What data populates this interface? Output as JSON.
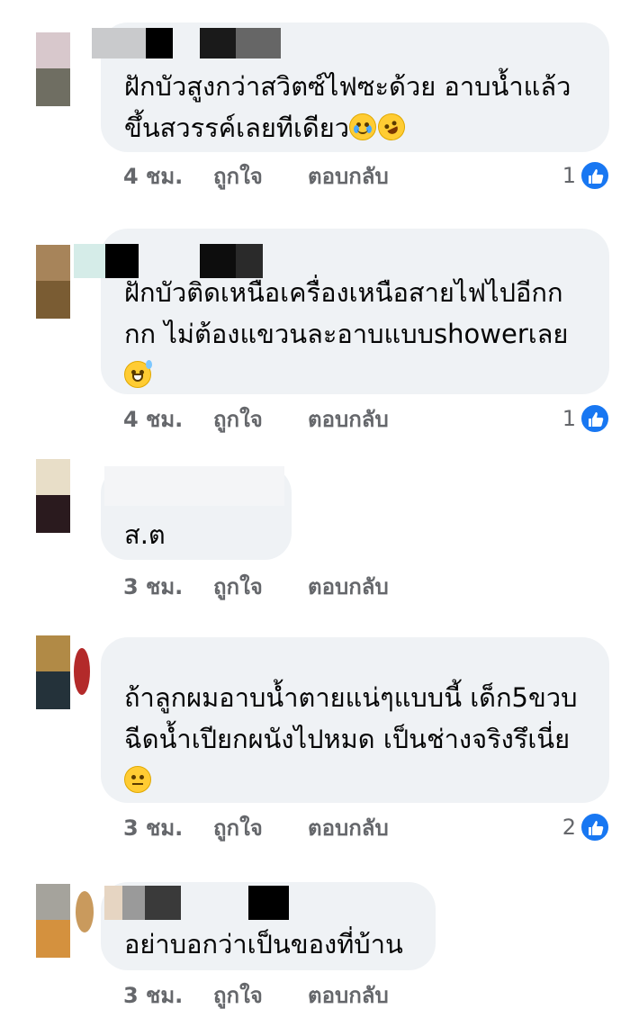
{
  "labels": {
    "like": "ถูกใจ",
    "reply": "ตอบกลับ"
  },
  "colors": {
    "bubble": "#eff2f5",
    "meta_text": "#65676b",
    "like_badge": "#1877f2"
  },
  "comments": [
    {
      "text": "ฝักบัวสูงกว่าสวิตซ์ไฟซะด้วย อาบน้ำแล้ว\nขึ้นสวรรค์เลยทีเดียว",
      "emojis": [
        "crying-face",
        "rolling-laughing-face"
      ],
      "time": "4 ชม.",
      "reactions": "1",
      "reaction_icon": "like-icon"
    },
    {
      "text": "ฝักบัวติดเหนือเครื่องเหนือสายไฟไปอีกก\nกก ไม่ต้องแขวนละอาบแบบshowerเลย",
      "emojis": [
        "grinning-sweat-face"
      ],
      "time": "4 ชม.",
      "reactions": "1",
      "reaction_icon": "like-icon"
    },
    {
      "text": "ส.ต",
      "emojis": [],
      "time": "3 ชม.",
      "reactions": "",
      "reaction_icon": ""
    },
    {
      "text": "ถ้าลูกผมอาบน้ำตายแน่ๆแบบนี้ เด็ก5ขวบ\nฉีดน้ำเปียกผนังไปหมด เป็นช่างจริงรึเนี่ย",
      "emojis": [
        "expressionless-face"
      ],
      "time": "3 ชม.",
      "reactions": "2",
      "reaction_icon": "like-icon"
    },
    {
      "text": "อย่าบอกว่าเป็นของที่บ้าน",
      "emojis": [],
      "time": "3 ชม.",
      "reactions": "",
      "reaction_icon": ""
    }
  ]
}
